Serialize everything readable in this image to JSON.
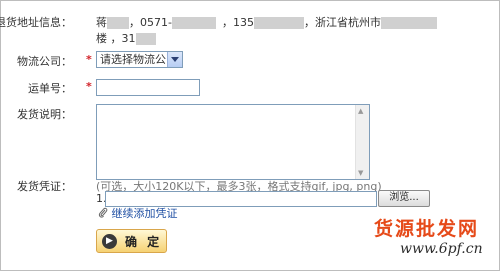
{
  "return_address": {
    "label": "退货地址信息：",
    "name_prefix": "蒋",
    "phone_prefix": "，0571-",
    "mobile_prefix": "，135",
    "address_start": "，浙江省杭州市",
    "line2_start": "楼 ，31"
  },
  "logistics": {
    "label": "物流公司：",
    "required_mark": "*",
    "selected": "请选择物流公司"
  },
  "tracking": {
    "label": "运单号：",
    "required_mark": "*",
    "value": ""
  },
  "shipping_note": {
    "label": "发货说明：",
    "value": ""
  },
  "voucher": {
    "label": "发货凭证：",
    "hint": "(可选，大小120K以下，最多3张，格式支持gif, jpg, png)",
    "index": "1.",
    "browse_label": "浏览...",
    "add_more_label": "继续添加凭证"
  },
  "confirm_label": "确 定",
  "watermark": {
    "title": "货源批发网",
    "url": "www.6pf.cn"
  }
}
